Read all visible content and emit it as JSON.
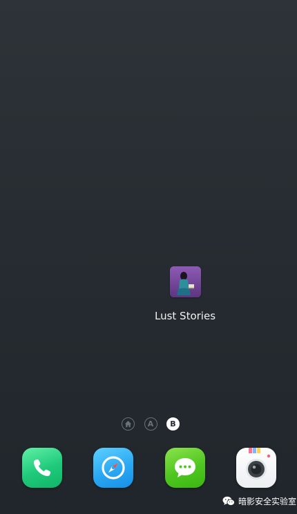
{
  "desktop": {
    "apps": [
      {
        "label": "Lust Stories",
        "icon": "lust-stories-app-icon"
      }
    ]
  },
  "pager": {
    "pages": [
      {
        "id": "home",
        "icon": "home-icon",
        "active": false
      },
      {
        "id": "a",
        "label": "A",
        "active": false
      },
      {
        "id": "b",
        "label": "B",
        "active": true
      }
    ]
  },
  "dock": {
    "apps": [
      {
        "name": "phone",
        "icon": "phone-icon",
        "color": "#1fc97a"
      },
      {
        "name": "browser",
        "icon": "compass-icon",
        "color": "#2ba8f3"
      },
      {
        "name": "messages",
        "icon": "chat-bubble-icon",
        "color": "#4fc620"
      },
      {
        "name": "camera",
        "icon": "camera-icon",
        "color": "#ffffff"
      }
    ]
  },
  "watermark": {
    "text": "暗影安全实验室",
    "icon": "wechat-icon"
  }
}
